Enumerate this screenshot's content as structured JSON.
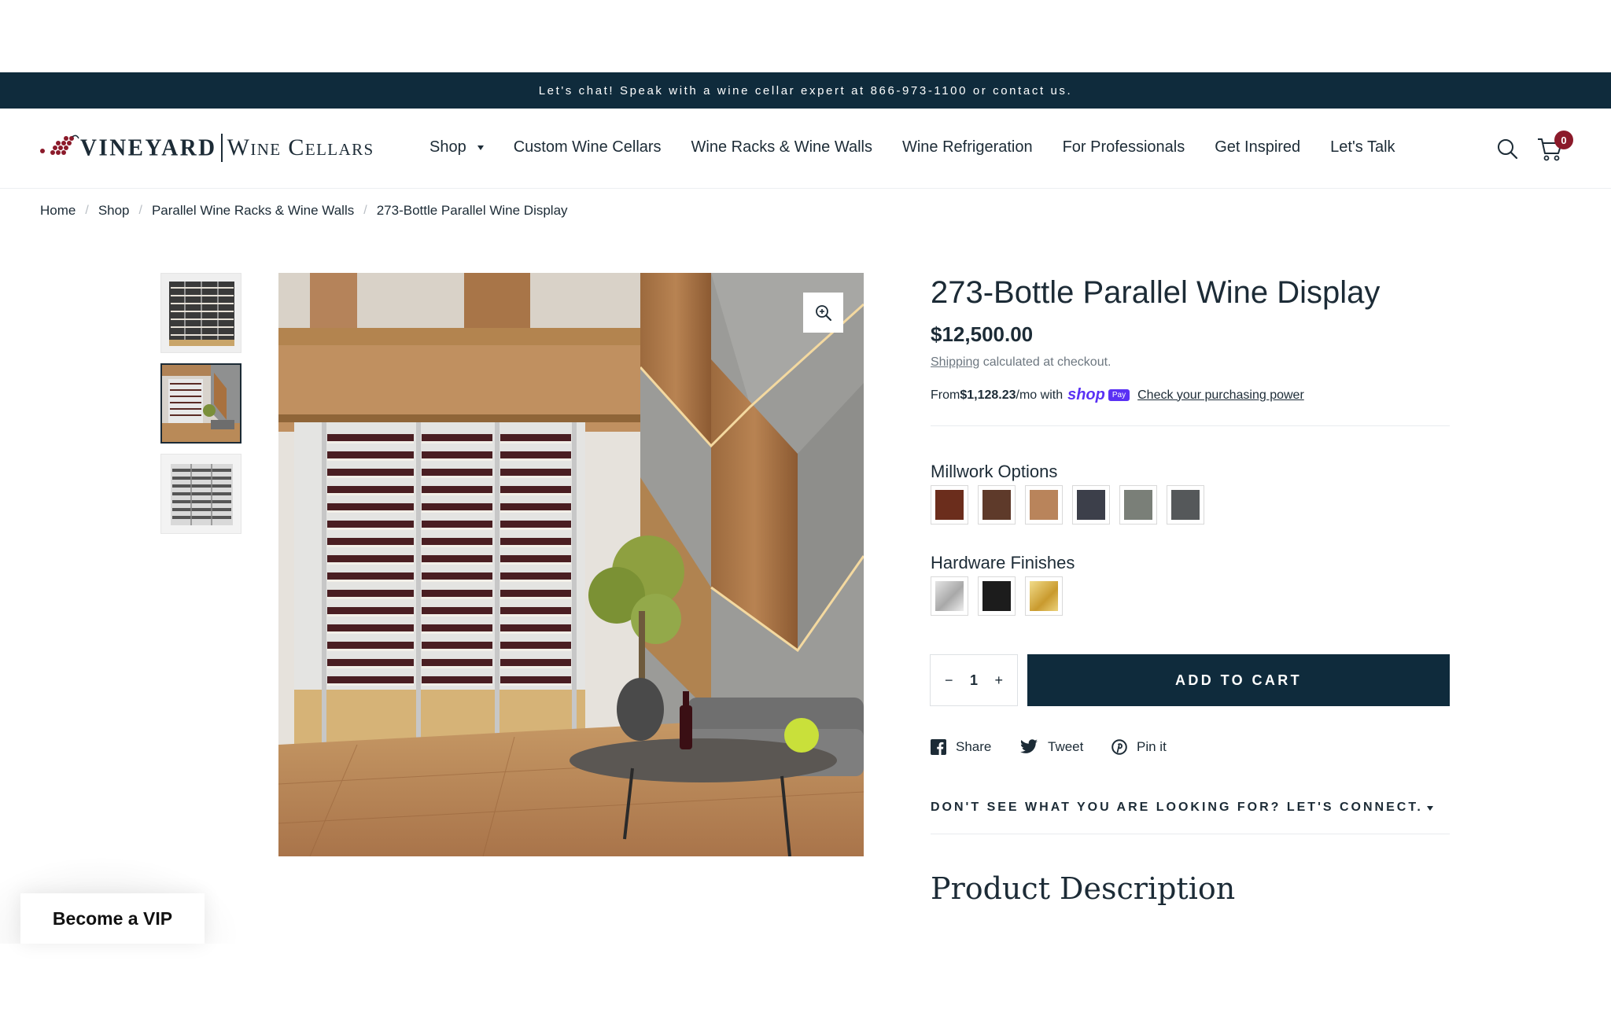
{
  "announcement": "Let's chat! Speak with a wine cellar expert at 866-973-1100 or contact us.",
  "logo": {
    "vineyard": "VINEYARD",
    "wine_cellars": "Wine Cellars"
  },
  "nav": {
    "items": [
      {
        "label": "Shop"
      },
      {
        "label": "Custom Wine Cellars"
      },
      {
        "label": "Wine Racks & Wine Walls"
      },
      {
        "label": "Wine Refrigeration"
      },
      {
        "label": "For Professionals"
      },
      {
        "label": "Get Inspired"
      },
      {
        "label": "Let's Talk"
      }
    ]
  },
  "cart": {
    "count": "0"
  },
  "breadcrumb": [
    "Home",
    "Shop",
    "Parallel Wine Racks & Wine Walls",
    "273-Bottle Parallel Wine Display"
  ],
  "product": {
    "title": "273-Bottle Parallel Wine Display",
    "price": "$12,500.00",
    "shipping_link": "Shipping",
    "shipping_text": " calculated at checkout.",
    "installments": {
      "prefix": "From ",
      "amount": "$1,128.23",
      "suffix": "/mo with",
      "shop_word": "shop",
      "pay_badge": "Pay",
      "link": "Check your purchasing power"
    },
    "millwork": {
      "label": "Millwork Options",
      "swatches": [
        {
          "name": "mahogany",
          "color": "#6b2d1c"
        },
        {
          "name": "walnut",
          "color": "#5e3a2a"
        },
        {
          "name": "light-oak",
          "color": "#b9845b"
        },
        {
          "name": "charcoal",
          "color": "#3c3f4a"
        },
        {
          "name": "gray-wash",
          "color": "#7a7f78"
        },
        {
          "name": "slate",
          "color": "#55585a"
        }
      ]
    },
    "hardware": {
      "label": "Hardware Finishes",
      "swatches": [
        {
          "name": "brushed-steel",
          "color": "#c8c8c8"
        },
        {
          "name": "matte-black",
          "color": "#1c1c1c"
        },
        {
          "name": "gold",
          "color": "#d6b550"
        }
      ]
    },
    "quantity": {
      "minus": "−",
      "value": "1",
      "plus": "+"
    },
    "add_to_cart": "ADD TO CART",
    "share": {
      "facebook": "Share",
      "twitter": "Tweet",
      "pinterest": "Pin it"
    },
    "connect": "DON'T SEE WHAT YOU ARE LOOKING FOR? LET'S CONNECT.",
    "description_title": "Product Description"
  },
  "vip": "Become a VIP",
  "colors": {
    "navy": "#0f2b3c",
    "accent": "#8b1a2a",
    "shop_pay": "#5a31f4"
  }
}
